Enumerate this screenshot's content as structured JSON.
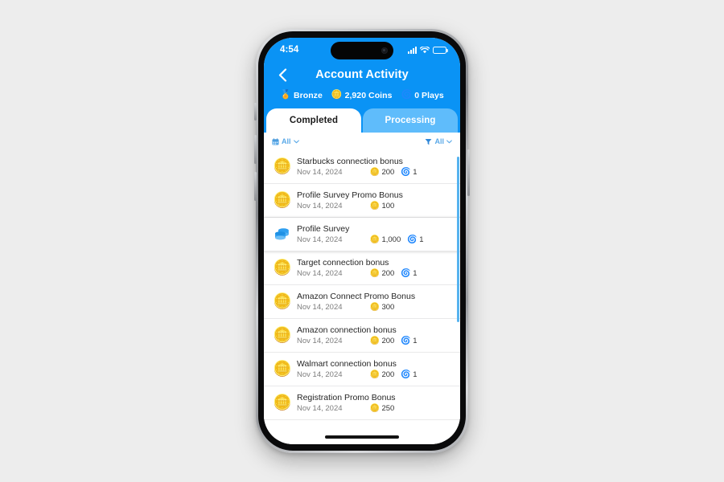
{
  "colors": {
    "brand_blue": "#0a93f5",
    "tab_inactive_blue": "#5fbcfb",
    "filter_blue": "#5aa9e8",
    "page_background": "#ededed",
    "scrollbar": "#57b3ef"
  },
  "status_bar": {
    "time": "4:54",
    "cellular_icon": "cellular-bars-icon",
    "wifi_icon": "wifi-icon",
    "battery_icon": "battery-icon"
  },
  "header": {
    "back_icon": "chevron-left-icon",
    "title": "Account Activity",
    "stats": [
      {
        "icon": "🏅",
        "icon_name": "medal-icon",
        "label": "Bronze"
      },
      {
        "icon": "🪙",
        "icon_name": "coins-icon",
        "label": "2,920 Coins"
      },
      {
        "icon": "🌀",
        "icon_name": "plays-token-icon",
        "label": "0 Plays"
      }
    ]
  },
  "tabs": [
    {
      "label": "Completed",
      "active": true
    },
    {
      "label": "Processing",
      "active": false
    }
  ],
  "filters": {
    "date": {
      "icon_name": "calendar-icon",
      "label": "All",
      "chevron": "chevron-down-icon"
    },
    "type": {
      "icon_name": "funnel-filter-icon",
      "label": "All",
      "chevron": "chevron-down-icon"
    }
  },
  "activity_list": [
    {
      "icon": "🪙",
      "icon_name": "coin-pile-icon",
      "icon_type": "coins",
      "title": "Starbucks connection bonus",
      "date": "Nov 14, 2024",
      "coins": "200",
      "plays": "1",
      "highlighted": false
    },
    {
      "icon": "🪙",
      "icon_name": "coin-pile-icon",
      "icon_type": "coins",
      "title": "Profile Survey Promo Bonus",
      "date": "Nov 14, 2024",
      "coins": "100",
      "plays": "",
      "highlighted": false
    },
    {
      "icon": "",
      "icon_name": "database-stack-icon",
      "icon_type": "database",
      "title": "Profile Survey",
      "date": "Nov 14, 2024",
      "coins": "1,000",
      "plays": "1",
      "highlighted": true
    },
    {
      "icon": "🪙",
      "icon_name": "coin-pile-icon",
      "icon_type": "coins",
      "title": "Target connection bonus",
      "date": "Nov 14, 2024",
      "coins": "200",
      "plays": "1",
      "highlighted": false
    },
    {
      "icon": "🪙",
      "icon_name": "coin-pile-icon",
      "icon_type": "coins",
      "title": "Amazon Connect Promo Bonus",
      "date": "Nov 14, 2024",
      "coins": "300",
      "plays": "",
      "highlighted": false
    },
    {
      "icon": "🪙",
      "icon_name": "coin-pile-icon",
      "icon_type": "coins",
      "title": "Amazon connection bonus",
      "date": "Nov 14, 2024",
      "coins": "200",
      "plays": "1",
      "highlighted": false
    },
    {
      "icon": "🪙",
      "icon_name": "coin-pile-icon",
      "icon_type": "coins",
      "title": "Walmart connection bonus",
      "date": "Nov 14, 2024",
      "coins": "200",
      "plays": "1",
      "highlighted": false
    },
    {
      "icon": "🪙",
      "icon_name": "coin-pile-icon",
      "icon_type": "coins",
      "title": "Registration Promo Bonus",
      "date": "Nov 14, 2024",
      "coins": "250",
      "plays": "",
      "highlighted": false
    }
  ],
  "reward_icons": {
    "coin": "🪙",
    "play": "🌀"
  }
}
